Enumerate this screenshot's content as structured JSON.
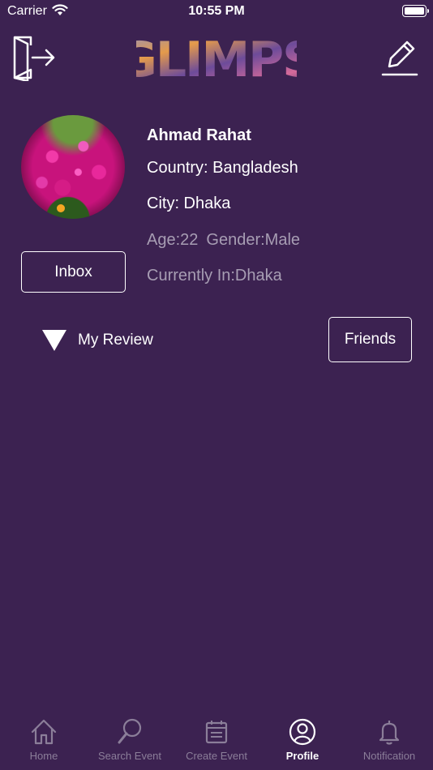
{
  "status_bar": {
    "carrier": "Carrier",
    "time": "10:55 PM"
  },
  "header": {
    "logo_text": "GLIMPS",
    "left_icon": "logout-icon",
    "right_icon": "edit-icon"
  },
  "profile": {
    "name": "Ahmad Rahat",
    "country": "Country: Bangladesh",
    "city": "City: Dhaka",
    "age": "Age:22",
    "gender": "Gender:Male",
    "currently_in": "Currently In:Dhaka",
    "inbox_label": "Inbox",
    "friends_label": "Friends",
    "review_label": "My Review"
  },
  "colors": {
    "background": "#3c2251",
    "muted_text": "#a79db3",
    "tab_inactive": "#8b7e99",
    "tab_active": "#ffffff"
  },
  "tabs": [
    {
      "label": "Home",
      "icon": "home-icon",
      "active": false
    },
    {
      "label": "Search Event",
      "icon": "search-icon",
      "active": false
    },
    {
      "label": "Create Event",
      "icon": "calendar-icon",
      "active": false
    },
    {
      "label": "Profile",
      "icon": "profile-icon",
      "active": true
    },
    {
      "label": "Notification",
      "icon": "bell-icon",
      "active": false
    }
  ]
}
